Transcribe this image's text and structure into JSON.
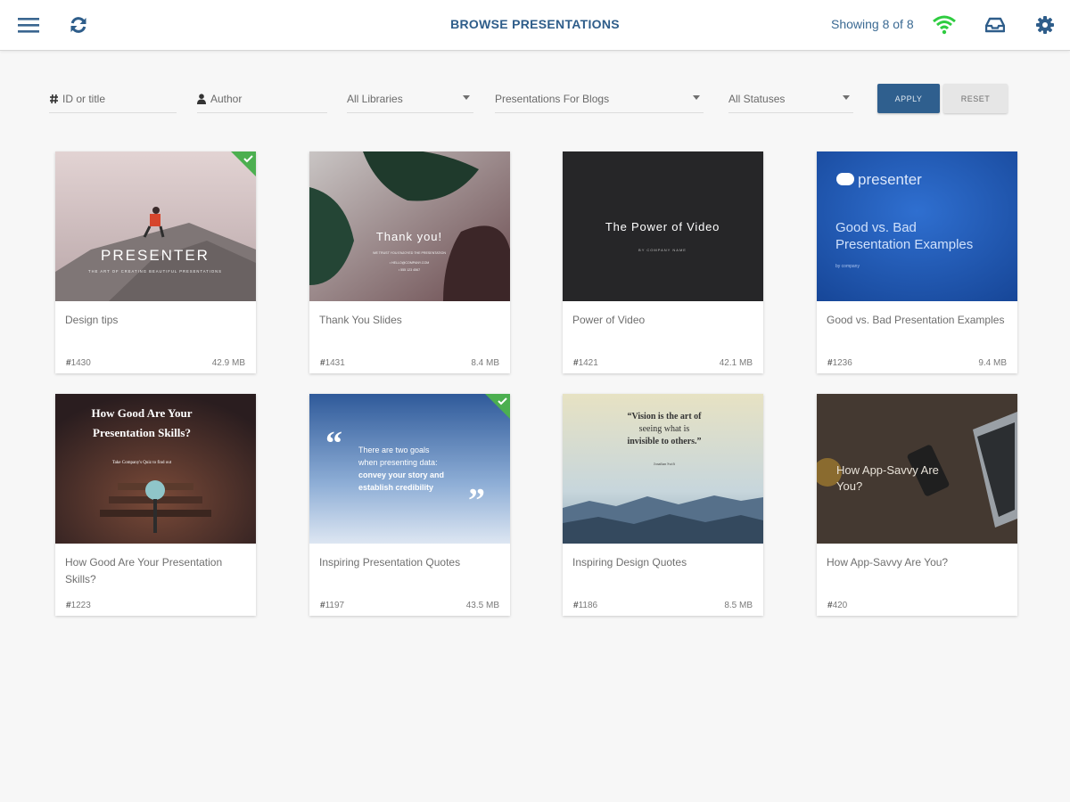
{
  "header": {
    "title": "BROWSE PRESENTATIONS",
    "showing": "Showing 8 of 8",
    "icons": [
      "menu-icon",
      "refresh-icon",
      "wifi-icon",
      "inbox-icon",
      "gear-icon"
    ],
    "wifi_color": "#2ecc40",
    "accent_color": "#2e5d8a"
  },
  "filters": {
    "id_placeholder": "ID or title",
    "author_placeholder": "Author",
    "library": "All Libraries",
    "collection": "Presentations For Blogs",
    "status": "All Statuses",
    "apply_label": "APPLY",
    "reset_label": "RESET"
  },
  "cards": [
    {
      "title": "Design tips",
      "id": "1430",
      "size": "42.9 MB",
      "checked": true,
      "thumb": {
        "heading": "PRESENTER",
        "tagline": "THE ART OF CREATING BEAUTIFUL PRESENTATIONS"
      }
    },
    {
      "title": "Thank You Slides",
      "id": "1431",
      "size": "8.4 MB",
      "checked": false,
      "thumb": {
        "heading": "Thank you!",
        "line1": "WE TRUST YOU ENJOYED THE PRESENTATION",
        "line2": "• HELLO@COMPANY.COM",
        "line3": "• 555 123 4567"
      }
    },
    {
      "title": "Power of Video",
      "id": "1421",
      "size": "42.1 MB",
      "checked": false,
      "thumb": {
        "heading": "The Power of Video",
        "subline": "BY COMPANY NAME"
      }
    },
    {
      "title": "Good vs. Bad Presentation Examples",
      "id": "1236",
      "size": "9.4 MB",
      "checked": false,
      "thumb": {
        "brand": "presenter",
        "line1": "Good vs. Bad",
        "line2": "Presentation Examples",
        "small": "by company"
      }
    },
    {
      "title": "How Good Are Your Presentation Skills?",
      "id": "1223",
      "size": "",
      "checked": false,
      "thumb": {
        "line1": "How Good Are Your",
        "line2": "Presentation Skills?",
        "small": "Take Company's Quiz to find out"
      }
    },
    {
      "title": "Inspiring Presentation Quotes",
      "id": "1197",
      "size": "43.5 MB",
      "checked": true,
      "thumb": {
        "line1": "There are two goals",
        "line2": "when presenting data:",
        "line3": "convey your story and",
        "line4": "establish credibility"
      }
    },
    {
      "title": "Inspiring Design Quotes",
      "id": "1186",
      "size": "8.5 MB",
      "checked": false,
      "thumb": {
        "line1": "“Vision is the art of",
        "line2": "seeing what is",
        "line3": "invisible to others.”",
        "author": "Jonathan Swift"
      }
    },
    {
      "title": "How App-Savvy Are You?",
      "id": "420",
      "size": "",
      "checked": false,
      "thumb": {
        "line1": "How App-Savvy Are",
        "line2": "You?"
      }
    }
  ]
}
